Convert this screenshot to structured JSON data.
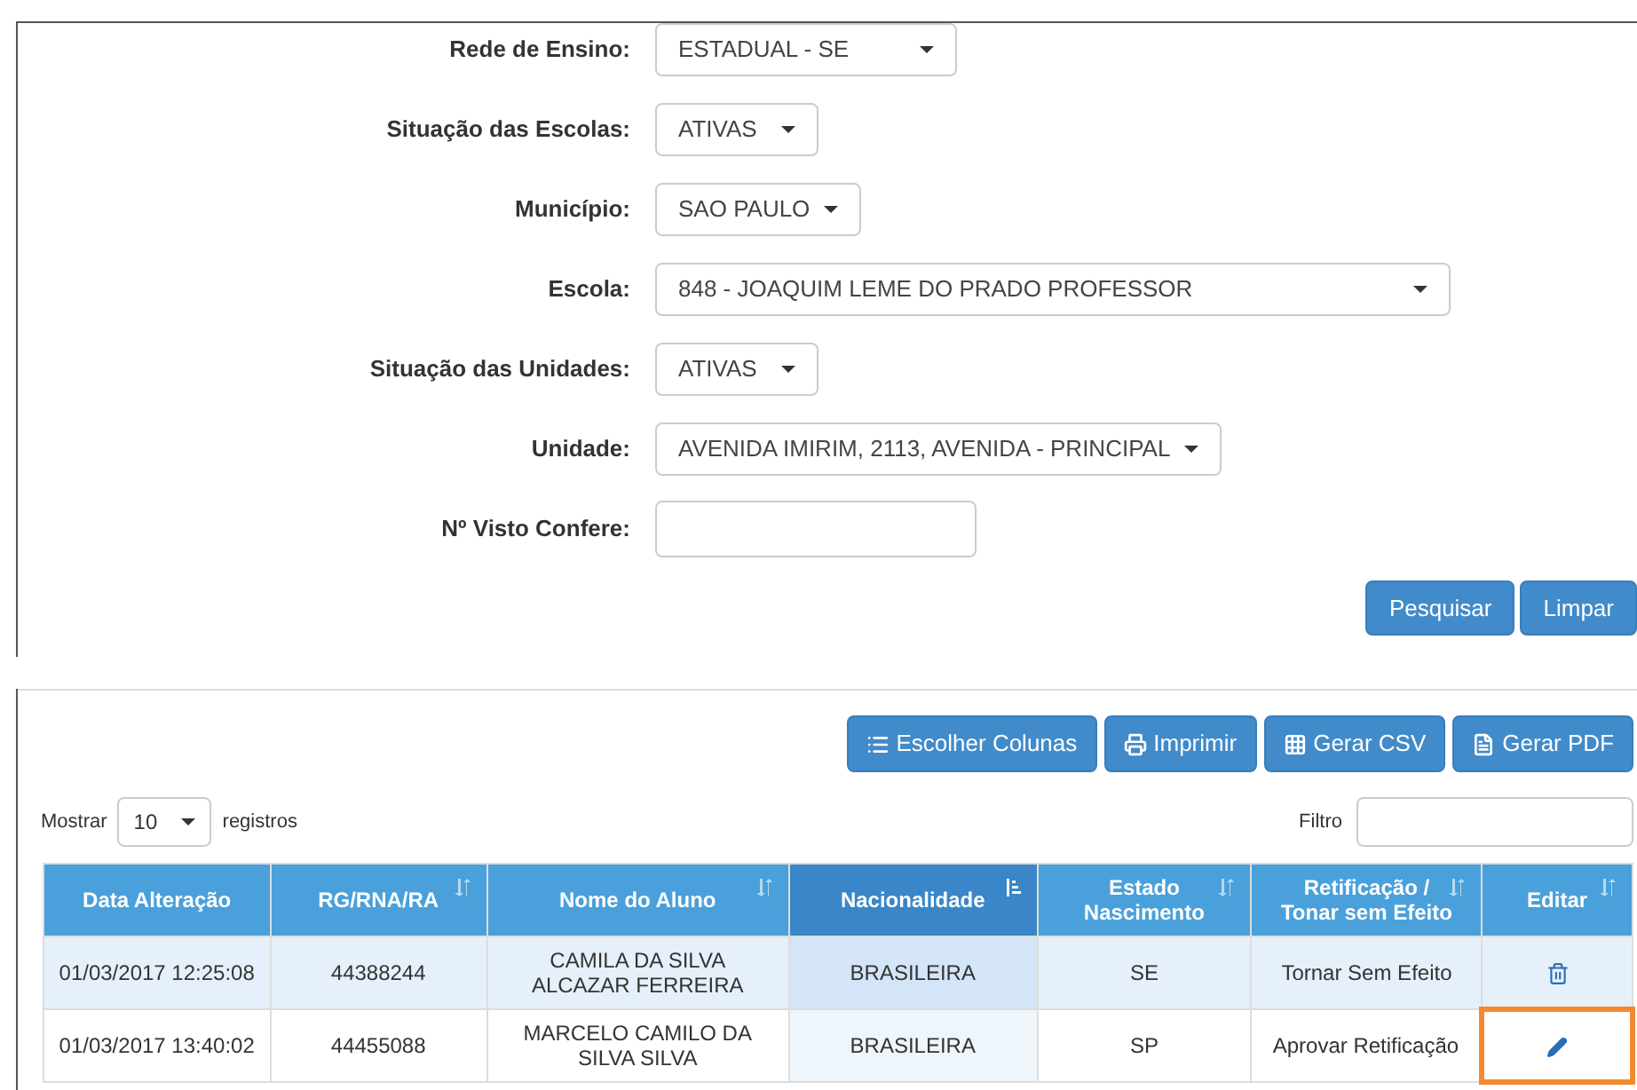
{
  "form": {
    "fields": [
      {
        "label": "Rede de Ensino:",
        "kind": "select",
        "value": "ESTADUAL - SE"
      },
      {
        "label": "Situação das Escolas:",
        "kind": "select",
        "value": "ATIVAS"
      },
      {
        "label": "Município:",
        "kind": "select",
        "value": "SAO PAULO"
      },
      {
        "label": "Escola:",
        "kind": "select",
        "value": "848 - JOAQUIM LEME DO PRADO PROFESSOR"
      },
      {
        "label": "Situação das Unidades:",
        "kind": "select",
        "value": "ATIVAS"
      },
      {
        "label": "Unidade:",
        "kind": "select",
        "value": "AVENIDA IMIRIM, 2113, AVENIDA - PRINCIPAL"
      },
      {
        "label": "Nº Visto Confere:",
        "kind": "text"
      }
    ],
    "buttons": [
      "Pesquisar",
      "Limpar"
    ]
  },
  "toolbar": [
    {
      "label": "Escolher Colunas"
    },
    {
      "label": "Imprimir"
    },
    {
      "label": "Gerar CSV"
    },
    {
      "label": "Gerar PDF"
    }
  ],
  "length": {
    "prefix": "Mostrar",
    "value": "10",
    "suffix": "registros"
  },
  "filter": {
    "label": "Filtro"
  },
  "table": {
    "columns": [
      {
        "label": "Data Alteração",
        "sortable": false,
        "sorted": false
      },
      {
        "label": "RG/RNA/RA",
        "sortable": true,
        "sorted": false
      },
      {
        "label": "Nome do Aluno",
        "sortable": true,
        "sorted": false
      },
      {
        "label": "Nacionalidade",
        "sortable": true,
        "sorted": true
      },
      {
        "label": "Estado Nascimento",
        "sortable": true,
        "sorted": false
      },
      {
        "label": "Retificação / Tonar sem Efeito",
        "sortable": true,
        "sorted": false
      },
      {
        "label": "Editar",
        "sortable": true,
        "sorted": false
      }
    ],
    "rows": [
      {
        "cells": [
          "01/03/2017 12:25:08",
          "44388244",
          "CAMILA DA SILVA ALCAZAR FERREIRA",
          "BRASILEIRA",
          "SE",
          "Tornar Sem Efeito"
        ],
        "kind": "delete",
        "highlighted": false
      },
      {
        "cells": [
          "01/03/2017 13:40:02",
          "44455088",
          "MARCELO CAMILO DA SILVA SILVA",
          "BRASILEIRA",
          "SP",
          "Aprovar Retificação"
        ],
        "kind": "edit",
        "highlighted": true
      }
    ]
  }
}
